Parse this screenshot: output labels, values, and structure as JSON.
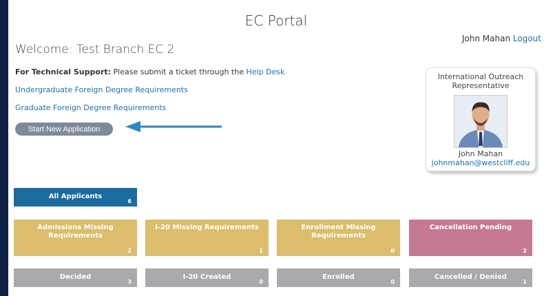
{
  "header": {
    "title": "EC Portal"
  },
  "user": {
    "name": "John Mahan",
    "logout_label": "Logout"
  },
  "welcome": "Welcome: Test Branch EC 2",
  "support": {
    "label": "For Technical Support:",
    "text": " Please submit a ticket through the ",
    "link": "Help Desk"
  },
  "links": {
    "undergrad": "Undergraduate Foreign Degree Requirements",
    "graduate": "Graduate Foreign Degree Requirements"
  },
  "start_button": "Start New Application",
  "rep": {
    "title": "International Outreach Representative",
    "name": "John Mahan",
    "email": "johnmahan@westcliff.edu"
  },
  "tiles": {
    "all": {
      "label": "All Applicants",
      "count": "6"
    },
    "admissions": {
      "label": "Admissions Missing Requirements",
      "count": "2"
    },
    "i20_missing": {
      "label": "I-20 Missing Requirements",
      "count": "1"
    },
    "enrollment": {
      "label": "Enrollment Missing Requirements",
      "count": "0"
    },
    "cancellation": {
      "label": "Cancellation Pending",
      "count": "2"
    },
    "decided": {
      "label": "Decided",
      "count": "3"
    },
    "i20_created": {
      "label": "I-20 Created",
      "count": "0"
    },
    "enrolled": {
      "label": "Enrolled",
      "count": "0"
    },
    "cancelled": {
      "label": "Cancelled / Denied",
      "count": "1"
    }
  },
  "colors": {
    "blue": "#1b6b9e",
    "gold": "#dbbd6b",
    "pink": "#c37a92",
    "grey": "#a9aaad",
    "link": "#1f6fb2",
    "arrow": "#2a87c8"
  }
}
